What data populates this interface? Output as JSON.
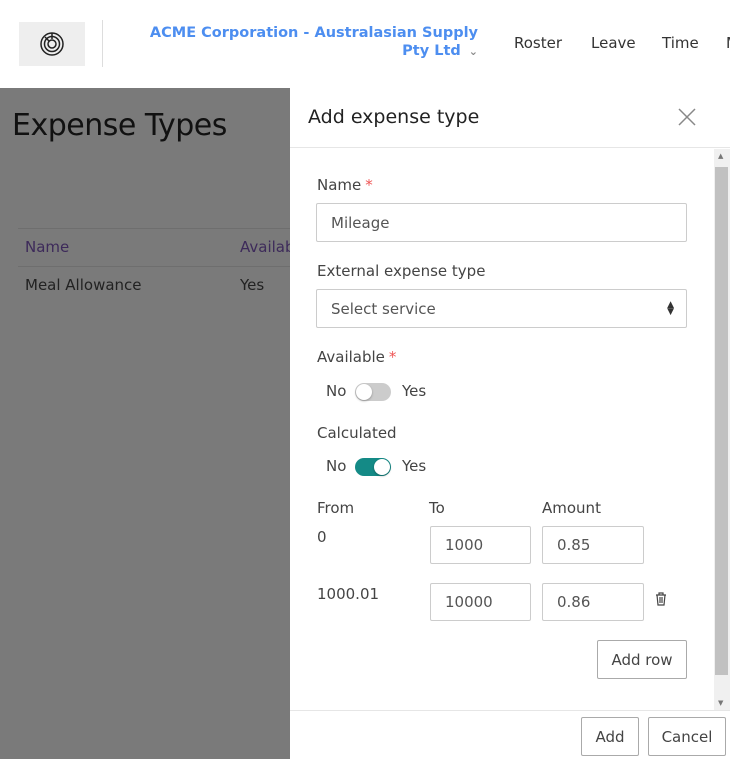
{
  "header": {
    "org": "ACME Corporation - Australasian Supply Pty Ltd",
    "nav": [
      "Roster",
      "Leave",
      "Time",
      "M"
    ]
  },
  "page": {
    "title": "Expense Types",
    "columns": [
      "Name",
      "Available"
    ],
    "rows": [
      {
        "name": "Meal Allowance",
        "available": "Yes"
      }
    ]
  },
  "drawer": {
    "title": "Add expense type",
    "name_label": "Name",
    "name_value": "Mileage",
    "external_label": "External expense type",
    "external_value": "Select service",
    "available_label": "Available",
    "available_no": "No",
    "available_yes": "Yes",
    "available_on": false,
    "calculated_label": "Calculated",
    "calculated_no": "No",
    "calculated_yes": "Yes",
    "calculated_on": true,
    "rate_headers": {
      "from": "From",
      "to": "To",
      "amount": "Amount"
    },
    "rates": [
      {
        "from": "0",
        "to": "1000",
        "amount": "0.85"
      },
      {
        "from": "1000.01",
        "to": "10000",
        "amount": "0.86"
      }
    ],
    "add_row": "Add row",
    "add": "Add",
    "cancel": "Cancel",
    "required_mark": "*",
    "accent": "#148a86"
  }
}
